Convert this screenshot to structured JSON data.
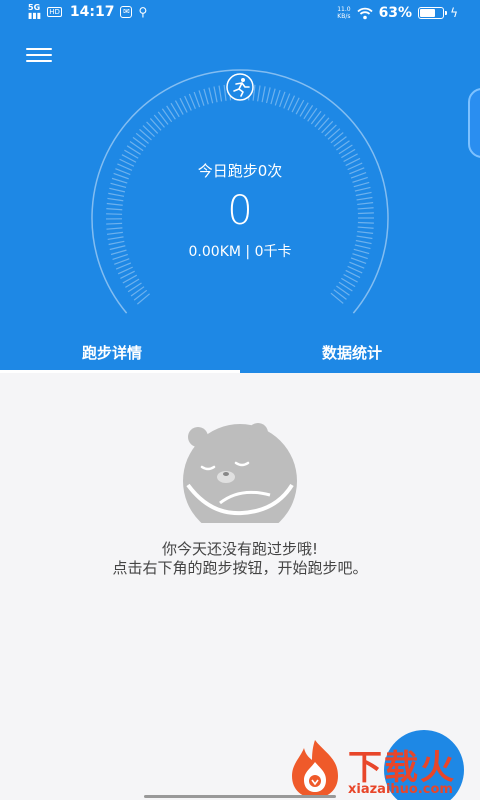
{
  "status_bar": {
    "network": "5G",
    "hd": "HD",
    "time": "14:17",
    "net_rate": "11.0",
    "net_rate_unit": "KB/s",
    "battery_percent": "63%",
    "battery_level": 0.63,
    "icons": [
      "signal-icon",
      "hd-icon",
      "notification-icon",
      "usb-icon",
      "wifi-icon",
      "battery-icon",
      "charging-icon"
    ]
  },
  "header": {
    "menu_icon": "menu-icon",
    "runner_icon": "runner-icon"
  },
  "summary": {
    "today_count": "今日跑步0次",
    "number": "0",
    "distance": "0.00KM | 0千卡"
  },
  "tabs": [
    {
      "label": "跑步详情",
      "active": true
    },
    {
      "label": "数据统计",
      "active": false
    }
  ],
  "empty_state": {
    "illustration": "sleeping-bear-icon",
    "line1": "你今天还没有跑过步哦!",
    "line2": "点击右下角的跑步按钮，开始跑步吧。"
  },
  "watermark": {
    "title": "下载火",
    "url": "xiazaihuo.com"
  },
  "colors": {
    "primary": "#1e88e5",
    "background": "#f5f5f7",
    "watermark": "#e8462a"
  }
}
